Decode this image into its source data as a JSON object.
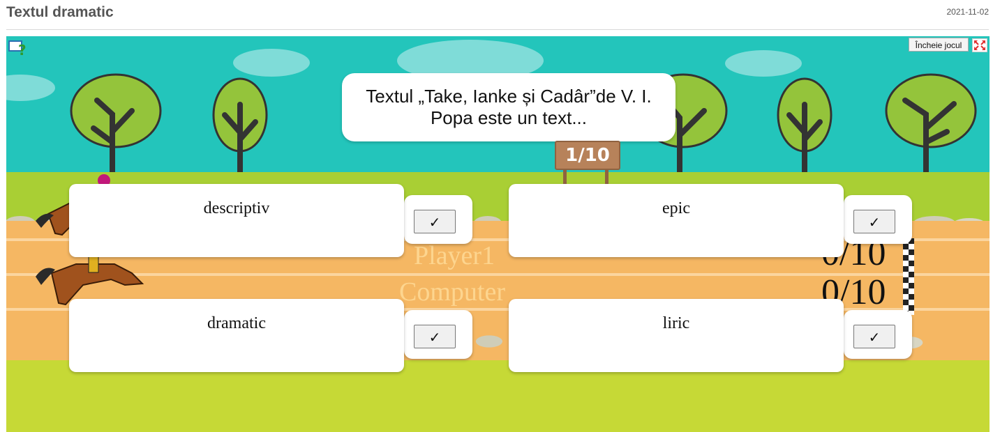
{
  "page": {
    "title": "Textul dramatic",
    "date": "2021-11-02"
  },
  "game": {
    "question": "Textul „Take, Ianke și Cadâr”de V. I. Popa este un text...",
    "progress": "1/10",
    "end_button": "Încheie jocul",
    "players": [
      {
        "name": "Player1",
        "score": "0/10"
      },
      {
        "name": "Computer",
        "score": "0/10"
      }
    ],
    "answers": [
      {
        "label": "descriptiv",
        "check": "✓"
      },
      {
        "label": "epic",
        "check": "✓"
      },
      {
        "label": "dramatic",
        "check": "✓"
      },
      {
        "label": "liric",
        "check": "✓"
      }
    ],
    "icons": {
      "help": "help-icon",
      "fullscreen": "fullscreen-icon"
    },
    "colors": {
      "sky": "#23c5bb",
      "grass": "#a9cf34",
      "track": "#f5b763",
      "ground": "#c6d936"
    }
  }
}
